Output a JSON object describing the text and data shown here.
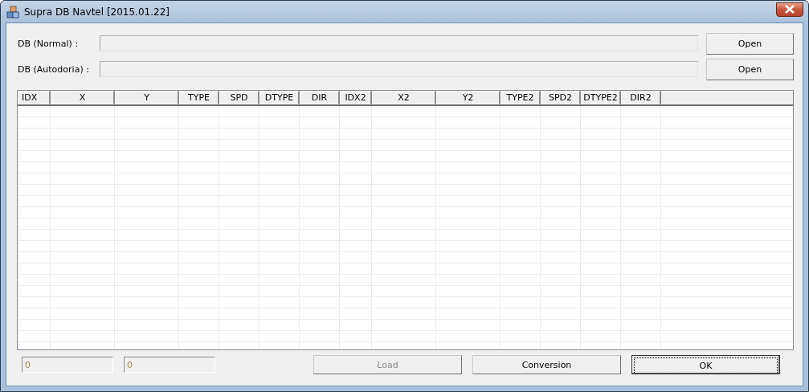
{
  "window": {
    "title": "Supra DB Navtel [2015.01.22]"
  },
  "paths": [
    {
      "label": "DB (Normal) :",
      "button": "Open"
    },
    {
      "label": "DB (Autodoria) :",
      "button": "Open"
    }
  ],
  "table": {
    "columns": [
      "IDX",
      "X",
      "Y",
      "TYPE",
      "SPD",
      "DTYPE",
      "DIR",
      "IDX2",
      "X2",
      "Y2",
      "TYPE2",
      "SPD2",
      "DTYPE2",
      "DIR2"
    ]
  },
  "counters": [
    {
      "value": "0"
    },
    {
      "value": "0"
    }
  ],
  "buttons": [
    {
      "label": "Load",
      "disabled": true,
      "default": false
    },
    {
      "label": "Conversion",
      "disabled": false,
      "default": false
    },
    {
      "label": "OK",
      "disabled": false,
      "default": true
    }
  ]
}
